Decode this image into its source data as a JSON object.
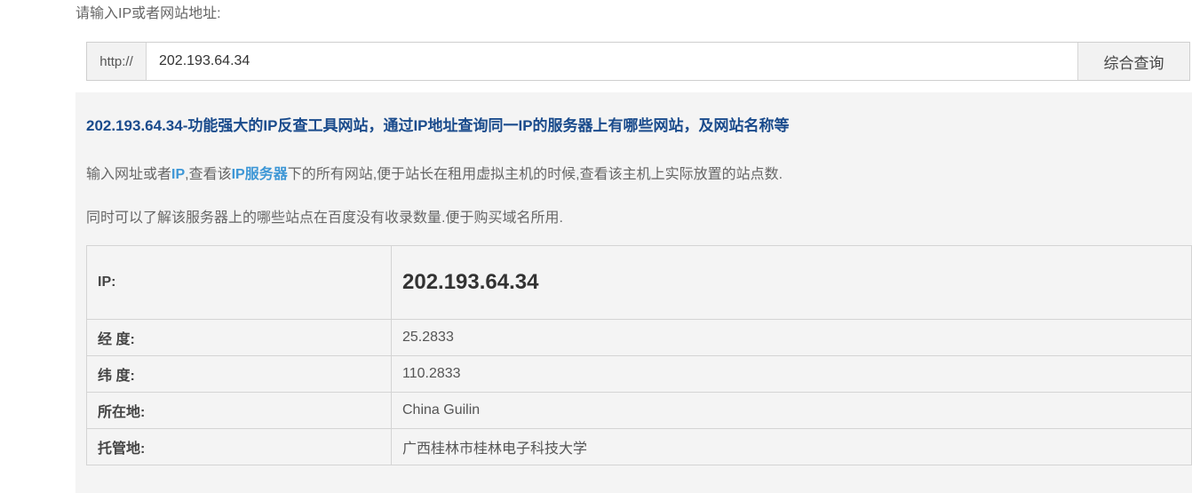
{
  "prompt_label": "请输入IP或者网站地址:",
  "search": {
    "prefix": "http://",
    "value": "202.193.64.34",
    "button_label": "综合查询"
  },
  "result": {
    "headline": "202.193.64.34-功能强大的IP反查工具网站，通过IP地址查询同一IP的服务器上有哪些网站，及网站名称等",
    "desc1": {
      "part1": "输入网址或者",
      "link1": "IP",
      "part2": ",查看该",
      "link2": "IP服务器",
      "part3": "下的所有网站,便于站长在租用虚拟主机的时候,查看该主机上实际放置的站点数."
    },
    "desc2": "同时可以了解该服务器上的哪些站点在百度没有收录数量.便于购买域名所用.",
    "rows": [
      {
        "key": "IP:",
        "value": "202.193.64.34"
      },
      {
        "key": "经 度:",
        "value": "25.2833"
      },
      {
        "key": "纬 度:",
        "value": "110.2833"
      },
      {
        "key": "所在地:",
        "value": "China Guilin"
      },
      {
        "key": "托管地:",
        "value": "广西桂林市桂林电子科技大学"
      }
    ]
  }
}
